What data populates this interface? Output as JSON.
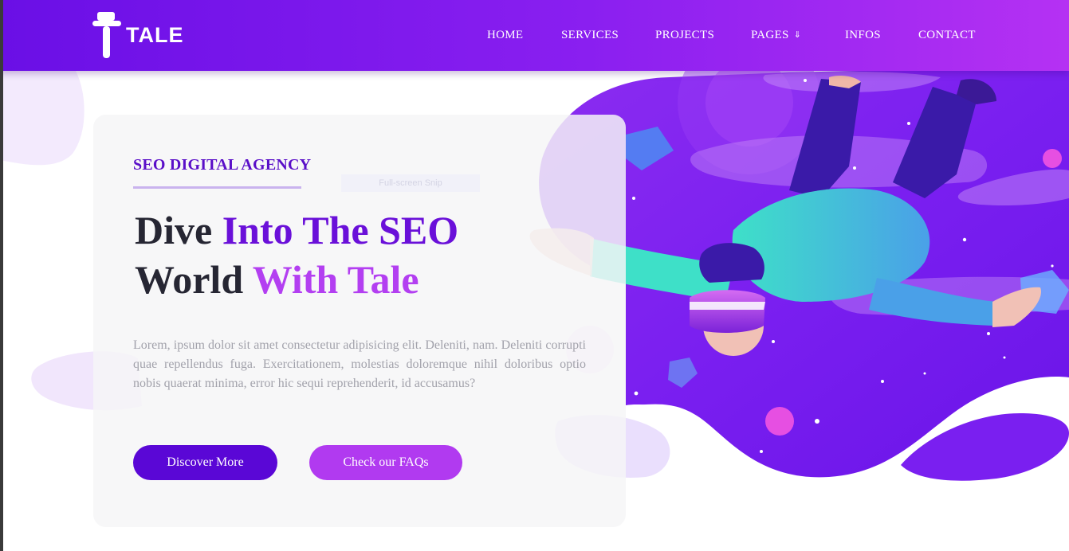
{
  "brand": {
    "name": "TALE",
    "logo_icon": "hat-t-logo-icon"
  },
  "nav": {
    "items": [
      {
        "label": "HOME"
      },
      {
        "label": "SERVICES"
      },
      {
        "label": "PROJECTS"
      },
      {
        "label": "PAGES",
        "dropdown_icon": "double-chevron-down-icon"
      },
      {
        "label": "INFOS"
      },
      {
        "label": "CONTACT"
      }
    ]
  },
  "hero": {
    "eyebrow": "SEO DIGITAL AGENCY",
    "title_part1": "Dive ",
    "title_part2": "Into The SEO",
    "title_part3": "World ",
    "title_part4": "With Tale",
    "description": "Lorem, ipsum dolor sit amet consectetur adipisicing elit. Deleniti, nam. Deleniti corrupti quae repellendus fuga. Exercitationem, molestias doloremque nihil doloribus optio nobis quaerat minima, error hic sequi reprehenderit, id accusamus?",
    "primary_button": "Discover More",
    "secondary_button": "Check our FAQs",
    "illustration": "vr-astronaut-illustration"
  },
  "overlay": {
    "label": "Full-screen Snip"
  },
  "colors": {
    "nav_start": "#6a0fe6",
    "nav_end": "#b531f3",
    "accent_dark": "#5a07d6",
    "accent_light": "#b13af0",
    "heading_dark": "#262633"
  }
}
